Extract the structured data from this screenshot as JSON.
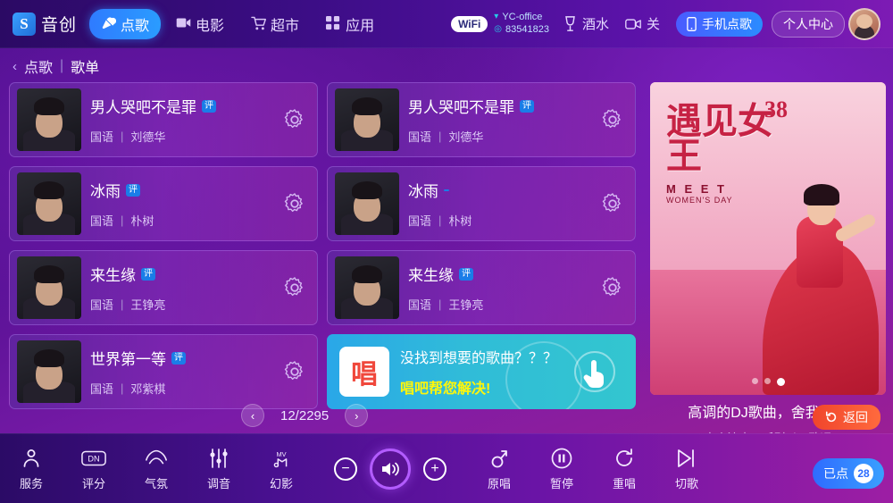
{
  "topbar": {
    "logo_mark": "S",
    "logo_text": "音创",
    "nav": [
      {
        "label": "点歌",
        "icon": "mic-icon",
        "active": true
      },
      {
        "label": "电影",
        "icon": "film-icon",
        "active": false
      },
      {
        "label": "超市",
        "icon": "cart-icon",
        "active": false
      },
      {
        "label": "应用",
        "icon": "grid-icon",
        "active": false
      }
    ],
    "wifi_label": "WiFi",
    "wifi_ssid": "YC-office",
    "wifi_id": "83541823",
    "tools": [
      {
        "label": "酒水",
        "icon": "wine-glass-icon"
      },
      {
        "label": "关",
        "icon": "video-off-icon"
      }
    ],
    "phone_order": "手机点歌",
    "user_center": "个人中心"
  },
  "breadcrumb": {
    "back_arrow": "‹",
    "root": "点歌",
    "separator": "|",
    "current": "歌单"
  },
  "songs": [
    {
      "title": "男人哭吧不是罪",
      "badge": "评",
      "lang": "国语",
      "artist": "刘德华"
    },
    {
      "title": "男人哭吧不是罪",
      "badge": "评",
      "lang": "国语",
      "artist": "刘德华"
    },
    {
      "title": "冰雨",
      "badge": "评",
      "lang": "国语",
      "artist": "朴树"
    },
    {
      "title": "冰雨",
      "badge": "",
      "lang": "国语",
      "artist": "朴树"
    },
    {
      "title": "来生缘",
      "badge": "评",
      "lang": "国语",
      "artist": "王铮亮"
    },
    {
      "title": "来生缘",
      "badge": "评",
      "lang": "国语",
      "artist": "王铮亮"
    },
    {
      "title": "世界第一等",
      "badge": "评",
      "lang": "国语",
      "artist": "邓紫棋"
    }
  ],
  "promo": {
    "icon_text": "唱",
    "line1": "没找到想要的歌曲？？？",
    "line2": "唱吧帮您解决!"
  },
  "ad": {
    "title_cn": "遇见女王",
    "number": "38",
    "meet": "M E E T",
    "sub_en": "WOMEN'S DAY",
    "dots": 3,
    "active_dot": 3,
    "caption1": "高调的DJ歌曲，舍我其谁",
    "caption2": "高山流水，听则以，致远"
  },
  "pager": {
    "prev": "‹",
    "next": "›",
    "text": "12/2295"
  },
  "back_button": {
    "label": "返回",
    "icon": "undo-icon"
  },
  "bottom": {
    "left_items": [
      {
        "label": "服务",
        "icon": "person-icon"
      },
      {
        "label": "评分",
        "icon": "score-icon"
      },
      {
        "label": "气氛",
        "icon": "mood-icon"
      },
      {
        "label": "调音",
        "icon": "sliders-icon"
      },
      {
        "label": "幻影",
        "icon": "mv-icon"
      }
    ],
    "volume": {
      "minus": "−",
      "plus": "+",
      "speaker_icon": "speaker-icon"
    },
    "right_items": [
      {
        "label": "原唱",
        "icon": "male-symbol-icon"
      },
      {
        "label": "暂停",
        "icon": "pause-icon"
      },
      {
        "label": "重唱",
        "icon": "replay-icon"
      },
      {
        "label": "切歌",
        "icon": "next-track-icon"
      }
    ],
    "counter_label": "已点",
    "counter_value": "28"
  },
  "colors": {
    "accent_blue": "#2a8cff",
    "promo_cyan": "#30bcd8",
    "back_red": "#f0452c",
    "badge_blue": "#1a7de8"
  }
}
